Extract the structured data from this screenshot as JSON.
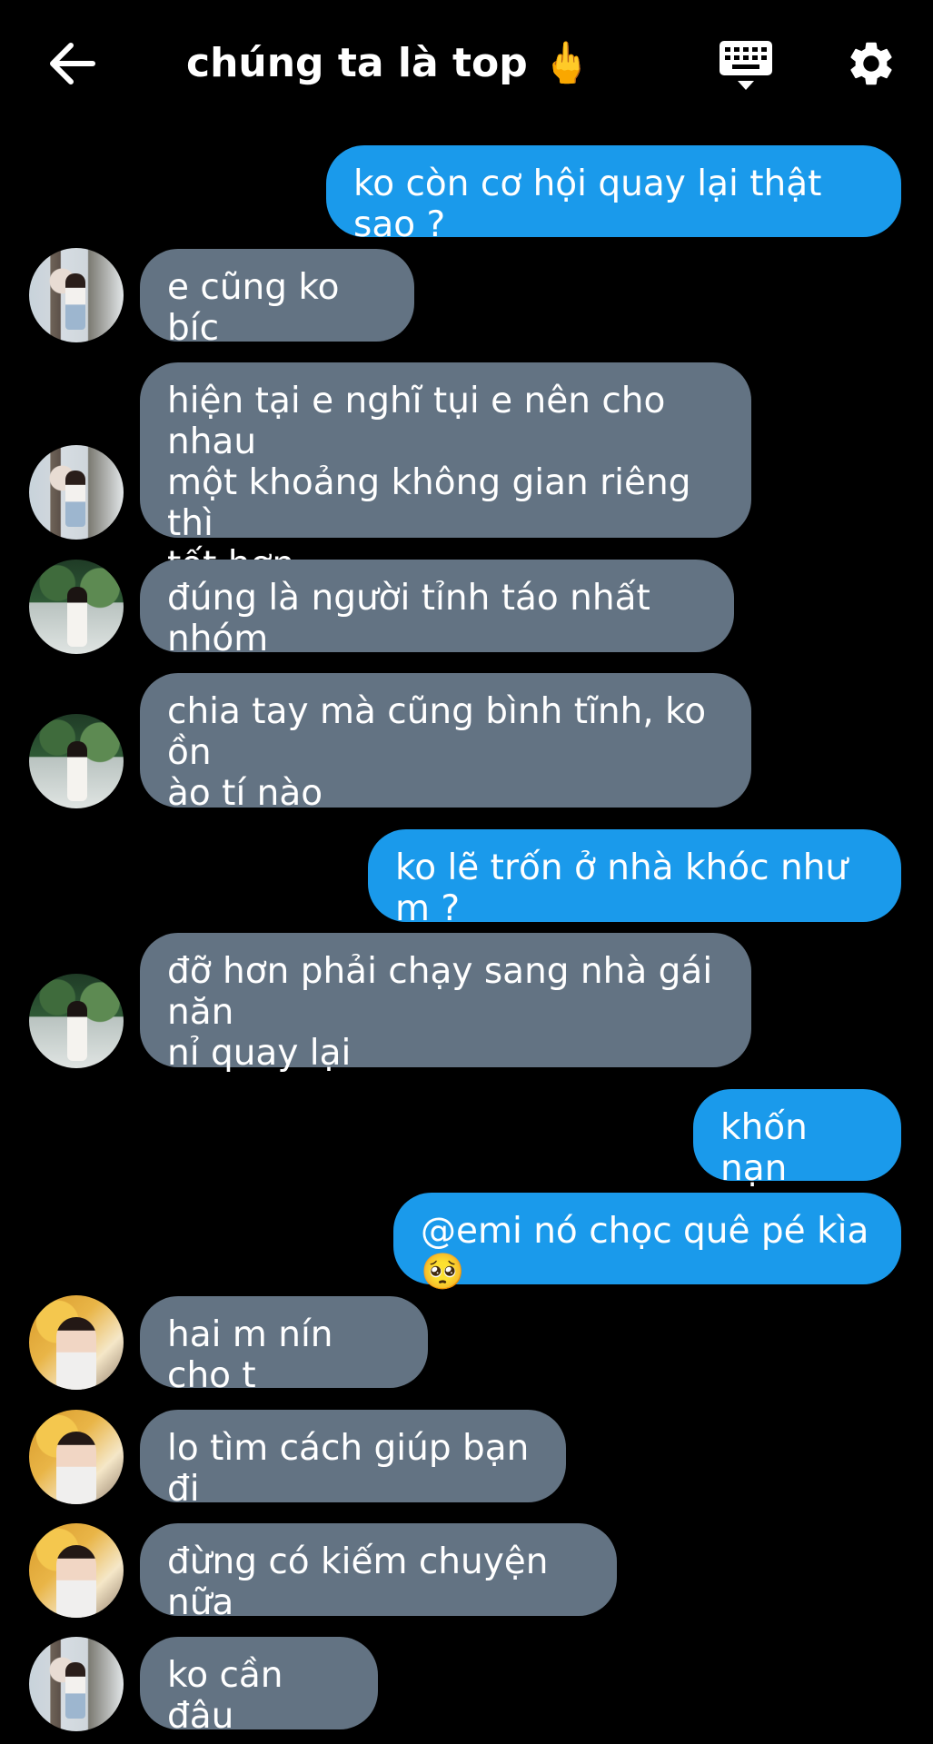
{
  "header": {
    "title": "chúng ta là top 🖕",
    "back_icon": "arrow-left-icon",
    "keyboard_icon": "keyboard-icon",
    "settings_icon": "gear-icon"
  },
  "colors": {
    "background": "#000000",
    "outgoing_bubble": "#1a9aeb",
    "incoming_bubble": "#637383",
    "text": "#ffffff"
  },
  "messages": [
    {
      "direction": "outgoing",
      "lines": [
        "ko còn cơ hội quay lại thật sao ?"
      ]
    },
    {
      "direction": "incoming",
      "lines": [
        "e cũng ko bíc"
      ]
    },
    {
      "direction": "incoming",
      "lines": [
        "hiện tại e nghĩ tụi e nên cho nhau",
        "một khoảng không gian riêng thì",
        "tốt hơn"
      ]
    },
    {
      "direction": "incoming",
      "lines": [
        "đúng là người tỉnh táo nhất nhóm"
      ]
    },
    {
      "direction": "incoming",
      "lines": [
        "chia tay mà cũng bình tĩnh, ko ồn",
        "ào tí nào"
      ]
    },
    {
      "direction": "outgoing",
      "lines": [
        "ko lẽ trốn ở nhà khóc như m ?"
      ]
    },
    {
      "direction": "incoming",
      "lines": [
        "đỡ hơn phải chạy sang nhà gái năn",
        "nỉ quay lại"
      ]
    },
    {
      "direction": "outgoing",
      "lines": [
        "khốn nạn"
      ]
    },
    {
      "direction": "outgoing",
      "lines": [
        "@emi nó chọc quê pé kìa 🥺"
      ]
    },
    {
      "direction": "incoming",
      "lines": [
        "hai m nín cho t"
      ]
    },
    {
      "direction": "incoming",
      "lines": [
        "lo tìm cách giúp bạn đi"
      ]
    },
    {
      "direction": "incoming",
      "lines": [
        "đừng có kiếm chuyện nữa"
      ]
    },
    {
      "direction": "incoming",
      "lines": [
        "ko cần đâu"
      ]
    }
  ]
}
